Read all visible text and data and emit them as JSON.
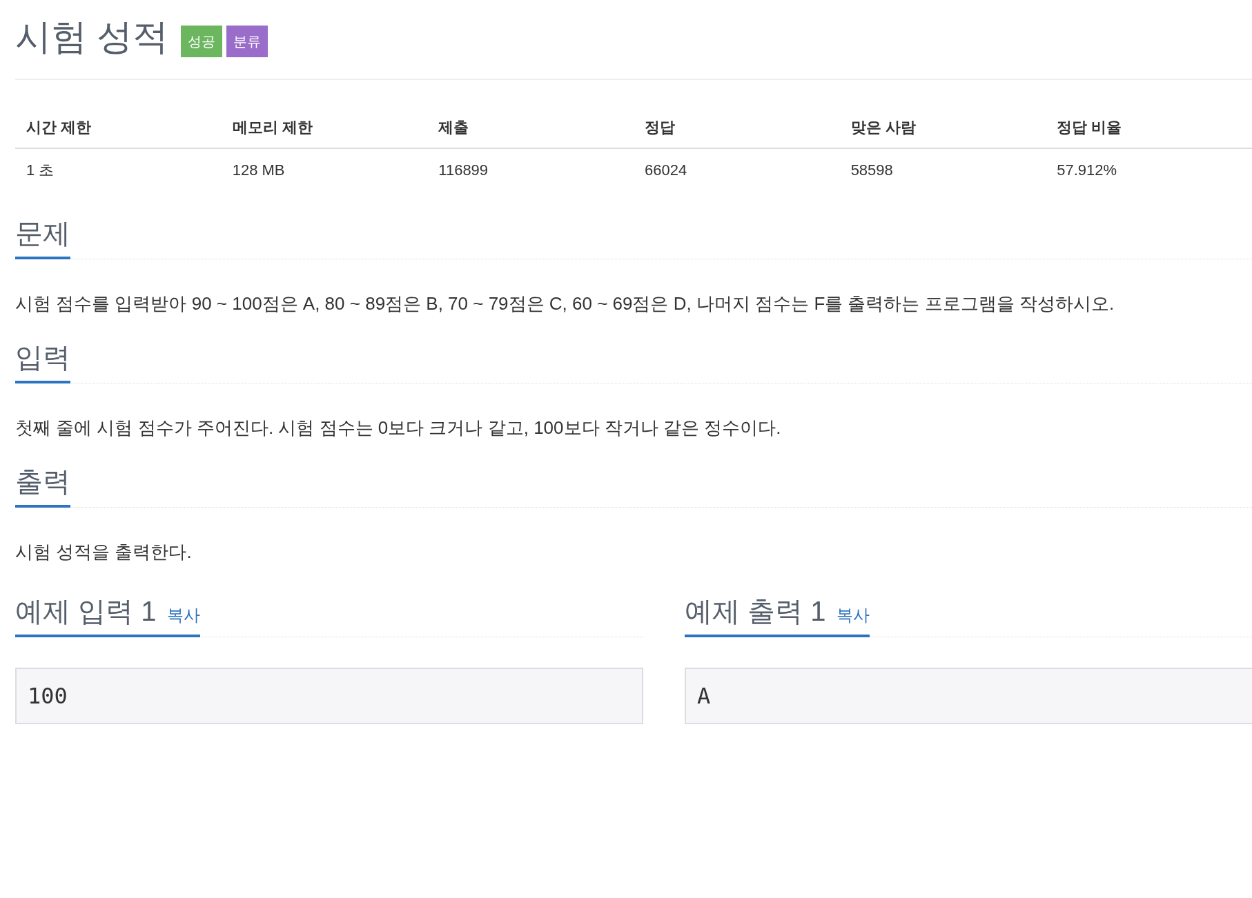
{
  "title": "시험 성적",
  "badges": [
    {
      "label": "성공",
      "color": "#6cb65f"
    },
    {
      "label": "분류",
      "color": "#9b6dca"
    }
  ],
  "info_table": {
    "columns": [
      "시간 제한",
      "메모리 제한",
      "제출",
      "정답",
      "맞은 사람",
      "정답 비율"
    ],
    "rows": [
      [
        "1 초",
        "128 MB",
        "116899",
        "66024",
        "58598",
        "57.912%"
      ]
    ]
  },
  "sections": [
    {
      "heading": "문제",
      "text": "시험 점수를 입력받아 90 ~ 100점은 A, 80 ~ 89점은 B, 70 ~ 79점은 C, 60 ~ 69점은 D, 나머지 점수는 F를 출력하는 프로그램을 작성하시오."
    },
    {
      "heading": "입력",
      "text": "첫째 줄에 시험 점수가 주어진다. 시험 점수는 0보다 크거나 같고, 100보다 작거나 같은 정수이다."
    },
    {
      "heading": "출력",
      "text": "시험 성적을 출력한다."
    }
  ],
  "samples": [
    {
      "heading": "예제 입력 1",
      "copy_link": "복사",
      "content": "100"
    },
    {
      "heading": "예제 출력 1",
      "copy_link": "복사",
      "content": "A"
    }
  ]
}
